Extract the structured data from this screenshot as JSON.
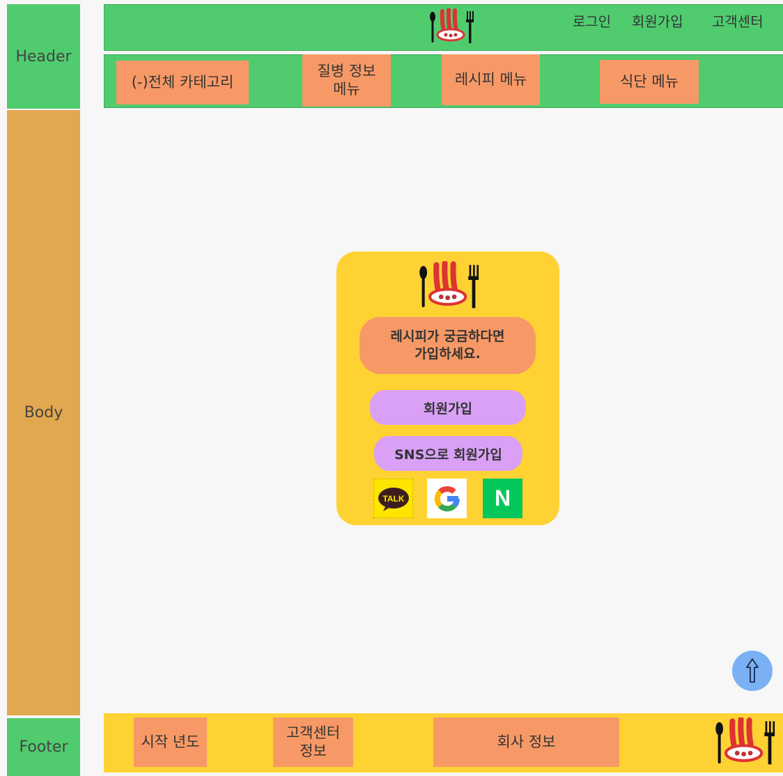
{
  "layout_labels": {
    "header": "Header",
    "body": "Body",
    "footer": "Footer"
  },
  "header": {
    "logo_icon": "restaurant-logo-icon",
    "links": [
      "로그인",
      "회원가입",
      "고객센터"
    ],
    "nav": [
      {
        "label": "(-)전체 카테고리"
      },
      {
        "label_line1": "질병 정보",
        "label_line2": "메뉴"
      },
      {
        "label": "레시피 메뉴"
      },
      {
        "label": "식단 메뉴"
      }
    ]
  },
  "signup_card": {
    "message_line1": "레시피가 궁금하다면",
    "message_line2": "가입하세요.",
    "signup_button": "회원가입",
    "sns_button": "SNS으로 회원가입",
    "kakao_label": "TALK",
    "naver_label": "N",
    "social_icons": [
      "kakao-talk-icon",
      "google-icon",
      "naver-icon"
    ]
  },
  "scroll_top_icon": "up-arrow-icon",
  "footer": {
    "start_year": "시작 년도",
    "support_line1": "고객센터",
    "support_line2": "정보",
    "company": "회사 정보"
  },
  "colors": {
    "green": "#50cc6f",
    "orange_side": "#e2a84f",
    "salmon": "#f79966",
    "yellow": "#ffd233",
    "purple": "#d9a0f5",
    "blue": "#7ab1f5"
  }
}
